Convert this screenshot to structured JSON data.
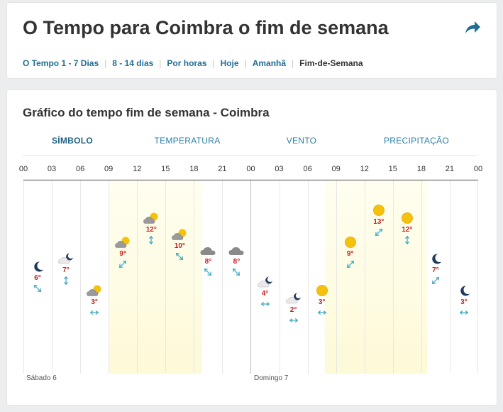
{
  "header": {
    "title": "O Tempo para Coimbra o fim de semana",
    "share_icon": "share-arrow-icon",
    "nav": [
      {
        "label": "O Tempo 1 - 7 Dias",
        "current": false
      },
      {
        "label": "8 - 14 dias",
        "current": false
      },
      {
        "label": "Por horas",
        "current": false
      },
      {
        "label": "Hoje",
        "current": false
      },
      {
        "label": "Amanhã",
        "current": false
      },
      {
        "label": "Fim-de-Semana",
        "current": true
      }
    ]
  },
  "chart": {
    "subtitle": "Gráfico do tempo fim de semana - Coimbra",
    "tabs": [
      {
        "label": "SÍMBOLO",
        "active": true
      },
      {
        "label": "TEMPERATURA",
        "active": false
      },
      {
        "label": "VENTO",
        "active": false
      },
      {
        "label": "PRECIPITAÇÃO",
        "active": false
      }
    ],
    "hours": [
      "00",
      "03",
      "06",
      "09",
      "12",
      "15",
      "18",
      "21",
      "00",
      "03",
      "06",
      "09",
      "12",
      "15",
      "18",
      "21",
      "00"
    ],
    "days": [
      "Sábado 6",
      "Domingo 7"
    ],
    "colors": {
      "temp": "#c8201f",
      "wind": "#3aa6c2",
      "sun": "#f4c20d",
      "cloud": "#8a8a8a",
      "moon": "#1f3a5a"
    }
  },
  "chart_data": {
    "type": "line",
    "x": [
      "Sáb 00",
      "Sáb 03",
      "Sáb 06",
      "Sáb 09",
      "Sáb 12",
      "Sáb 15",
      "Sáb 18",
      "Sáb 21",
      "Dom 00",
      "Dom 03",
      "Dom 06",
      "Dom 09",
      "Dom 12",
      "Dom 15",
      "Dom 18",
      "Dom 21"
    ],
    "series": [
      {
        "values": [
          6,
          7,
          3,
          9,
          12,
          10,
          8,
          8,
          4,
          2,
          3,
          9,
          13,
          12,
          7,
          3
        ]
      }
    ],
    "temp_labels": [
      "6°",
      "7°",
      "3°",
      "9°",
      "12°",
      "10°",
      "8°",
      "8°",
      "4°",
      "2°",
      "3°",
      "9°",
      "13°",
      "12°",
      "7°",
      "3°"
    ],
    "icons": [
      "moon-icon",
      "moon-cloud-icon",
      "sun-cloud-icon",
      "sun-cloud-icon",
      "sun-cloud-icon",
      "sun-cloud-icon",
      "cloud-icon",
      "cloud-icon",
      "moon-cloud-icon",
      "moon-cloud-icon",
      "sun-icon",
      "sun-icon",
      "sun-icon",
      "sun-icon",
      "moon-icon",
      "moon-icon"
    ],
    "wind_directions": [
      "↘",
      "↕",
      "↔",
      "↙",
      "↕",
      "↘",
      "↘",
      "↘",
      "↔",
      "↔",
      "↔",
      "↙",
      "↙",
      "↕",
      "↙",
      "↔"
    ],
    "ylim": [
      0,
      15
    ]
  }
}
